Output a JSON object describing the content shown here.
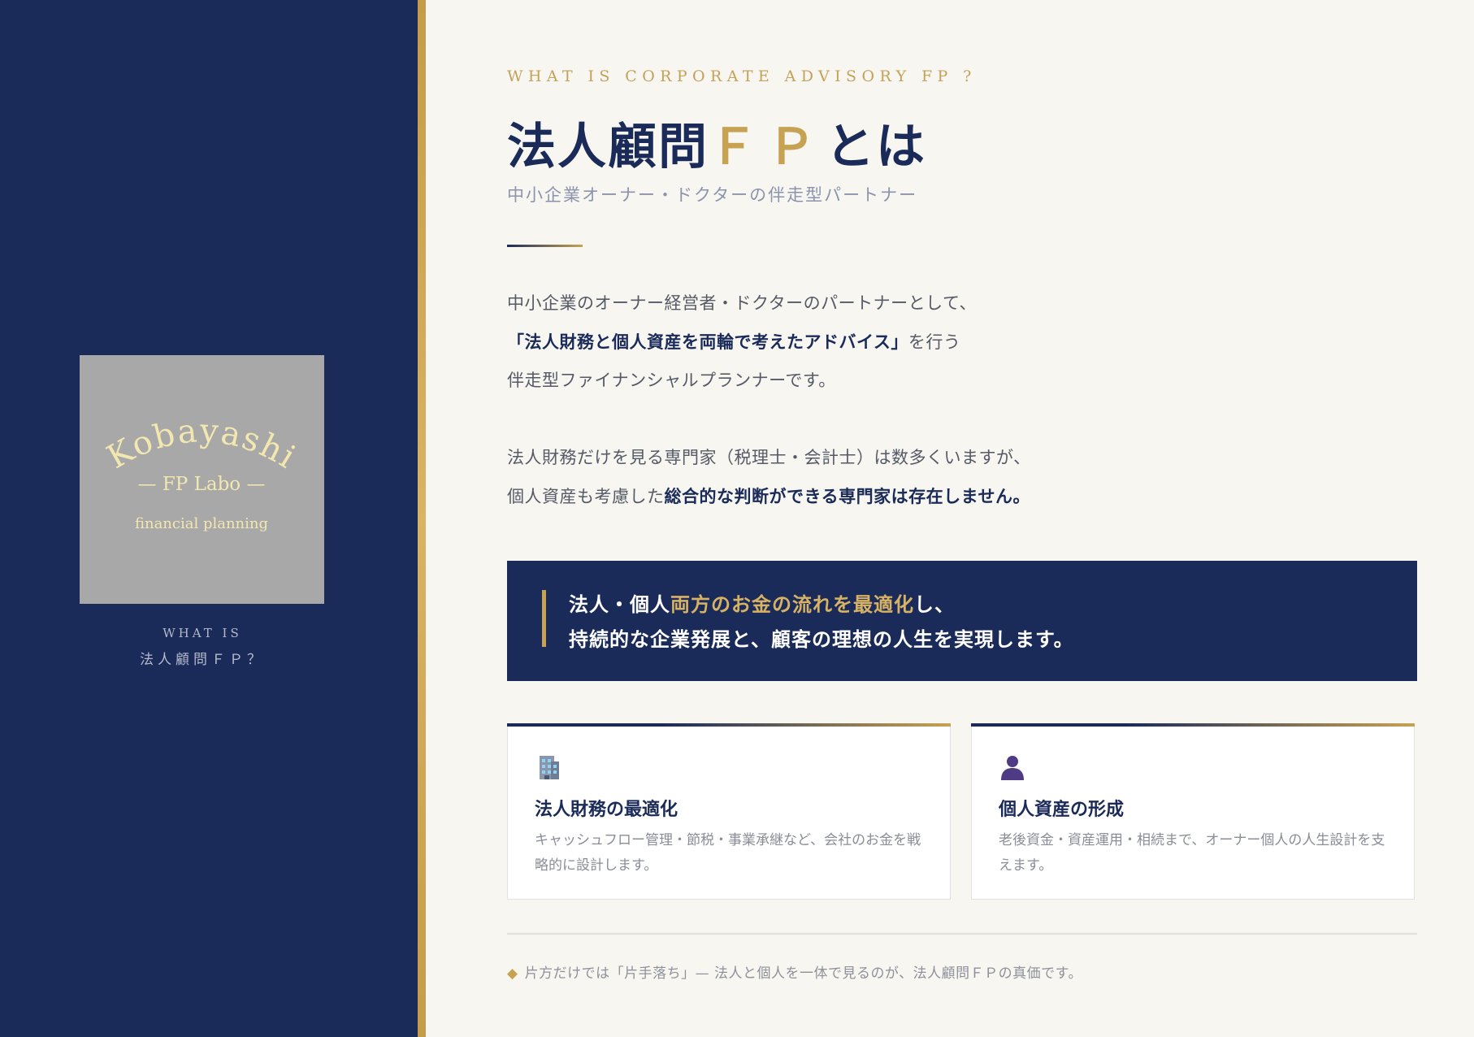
{
  "sidebar": {
    "logo": {
      "name": "Kobayashi",
      "sub": "— FP Labo —",
      "tagline": "financial planning"
    },
    "caption_en": "WHAT IS",
    "caption_jp": "法人顧問ＦＰ？"
  },
  "main": {
    "eyebrow": "WHAT IS CORPORATE ADVISORY FP ?",
    "title_part1": "法人顧問",
    "title_accent": "ＦＰ",
    "title_part2": "とは",
    "subtitle": "中小企業オーナー・ドクターの伴走型パートナー",
    "para1": {
      "line1": "中小企業のオーナー経営者・ドクターのパートナーとして、",
      "line2_strong": "「法人財務と個人資産を両輪で考えたアドバイス」",
      "line2_rest": "を行う",
      "line3": "伴走型ファイナンシャルプランナーです。"
    },
    "para2": {
      "line1": "法人財務だけを見る専門家（税理士・会計士）は数多くいますが、",
      "line2_plain": "個人資産も考慮した",
      "line2_strong": "総合的な判断ができる専門家は存在しません。"
    },
    "callout": {
      "line1_a": "法人・個人",
      "line1_hl": "両方のお金の流れを最適化",
      "line1_b": "し、",
      "line2": "持続的な企業発展と、顧客の理想の人生を実現します。"
    },
    "cards": [
      {
        "icon": "office-building-icon",
        "title": "法人財務の最適化",
        "text": "キャッシュフロー管理・節税・事業承継など、会社のお金を戦略的に設計します。"
      },
      {
        "icon": "person-silhouette-icon",
        "title": "個人資産の形成",
        "text": "老後資金・資産運用・相続まで、オーナー個人の人生設計を支えます。"
      }
    ],
    "footer_note": "片方だけでは「片手落ち」— 法人と個人を一体で見るのが、法人顧問ＦＰの真価です。"
  },
  "colors": {
    "navy": "#1b2b59",
    "gold": "#c8a253",
    "background": "#f7f6f1",
    "logo_bg": "#a8a8a8",
    "logo_text": "#f3e7b0"
  }
}
